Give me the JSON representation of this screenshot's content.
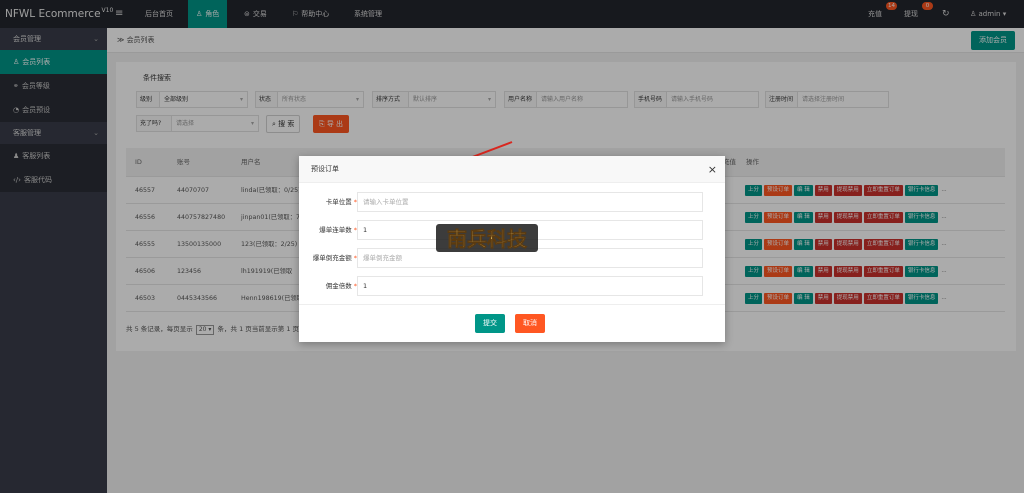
{
  "app": {
    "brand": "NFWL Ecommerce",
    "version": "V10"
  },
  "topnav": {
    "menu_toggle": "≡",
    "items": [
      {
        "label": "后台首页"
      },
      {
        "label": "角色"
      },
      {
        "label": "交易"
      },
      {
        "label": "帮助中心"
      },
      {
        "label": "系统管理"
      }
    ],
    "recharge": {
      "label": "充值",
      "badge": "14"
    },
    "withdraw": {
      "label": "提现",
      "badge": "0"
    },
    "refresh": "↻",
    "user": "admin",
    "user_caret": "▾"
  },
  "sidebar": {
    "groups": [
      {
        "label": "会员管理",
        "items": [
          {
            "label": "会员列表"
          },
          {
            "label": "会员等级"
          },
          {
            "label": "会员预设"
          }
        ]
      },
      {
        "label": "客服管理",
        "items": [
          {
            "label": "客服列表"
          },
          {
            "label": "客服代码"
          }
        ]
      }
    ]
  },
  "breadcrumb": {
    "label": "会员列表",
    "sep": "≫"
  },
  "add_member_button": "添加会员",
  "filter": {
    "legend": "条件搜索",
    "fields": [
      {
        "label": "级别",
        "value": "全部级别"
      },
      {
        "label": "状态",
        "placeholder": "所有状态"
      },
      {
        "label": "排序方式",
        "placeholder": "默认排序"
      },
      {
        "label": "用户名称",
        "placeholder": "请输入用户名称"
      },
      {
        "label": "手机号码",
        "placeholder": "请输入手机号码"
      },
      {
        "label": "注册时间",
        "placeholder": "请选择注册时间"
      },
      {
        "label": "充了吗?",
        "placeholder": "请选择"
      }
    ],
    "search_button": "搜 索",
    "export_button": "导 出"
  },
  "table": {
    "headers": [
      "ID",
      "账号",
      "用户名",
      "充值",
      "操作"
    ],
    "rows": [
      {
        "id": "46557",
        "account": "44070707",
        "username": "linda(已领取：0/25)"
      },
      {
        "id": "46556",
        "account": "440757827480",
        "username": "jinpan01(已领取：7"
      },
      {
        "id": "46555",
        "account": "13500135000",
        "username": "123(已领取：2/25)"
      },
      {
        "id": "46506",
        "account": "123456",
        "username": "lh191919(已领取"
      },
      {
        "id": "46503",
        "account": "0445343566",
        "username": "Henn198619(已领取"
      }
    ],
    "actions": [
      "上分",
      "预设订单",
      "编 辑",
      "禁用",
      "提现禁用",
      "立即重置订单",
      "银行卡信息",
      "..."
    ],
    "footer": {
      "prefix": "共 5 条记录，每页显示",
      "page_size": "20",
      "suffix": "条，共 1 页当前显示第 1 页"
    }
  },
  "modal": {
    "title": "预设订单",
    "close": "×",
    "fields": [
      {
        "label": "卡单位置",
        "placeholder": "请输入卡单位置"
      },
      {
        "label": "爆单连单数",
        "value": "1"
      },
      {
        "label": "爆单倒充金额",
        "placeholder": "爆单倒充金额"
      },
      {
        "label": "佣金倍数",
        "value": "1"
      }
    ],
    "submit": "提交",
    "cancel": "取消"
  },
  "watermark": {
    "text": "南兵科技"
  }
}
